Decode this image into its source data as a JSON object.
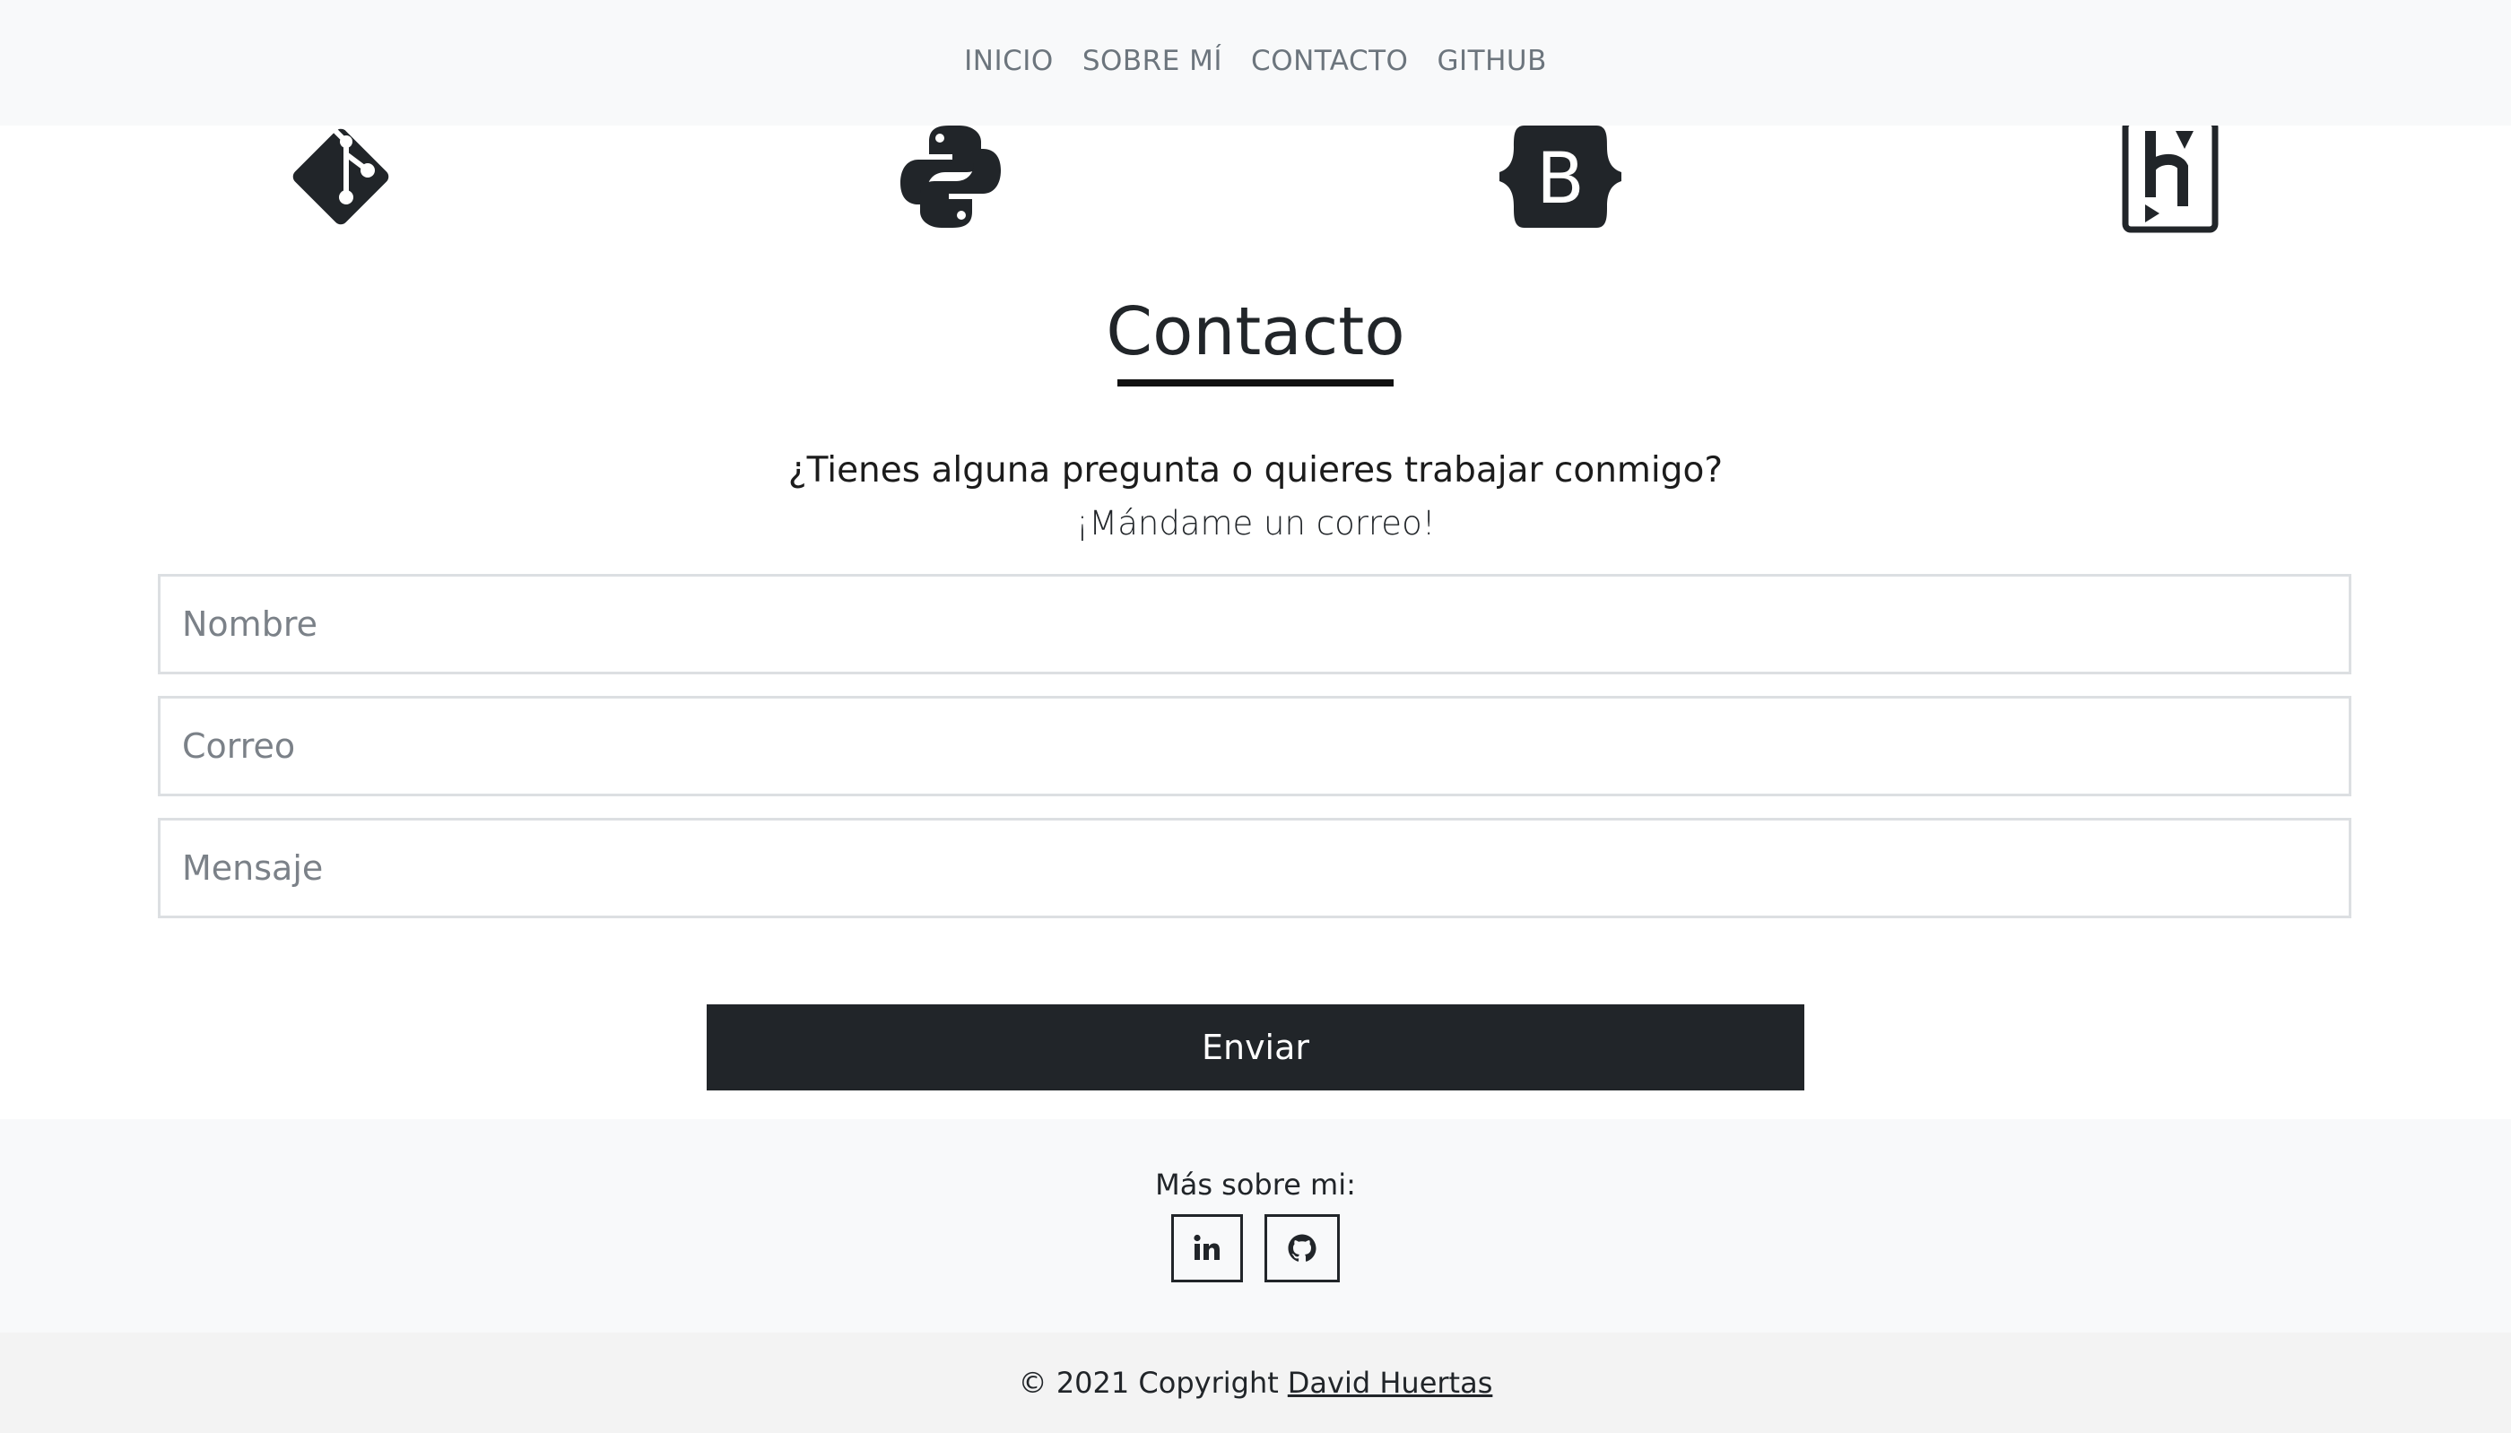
{
  "nav": {
    "items": [
      {
        "label": "INICIO"
      },
      {
        "label": "SOBRE MÍ"
      },
      {
        "label": "CONTACTO"
      },
      {
        "label": "GITHUB"
      }
    ]
  },
  "skills": [
    {
      "icon": "git-icon"
    },
    {
      "icon": "python-icon"
    },
    {
      "icon": "bootstrap-icon"
    },
    {
      "icon": "heroku-icon"
    }
  ],
  "contact": {
    "title": "Contacto",
    "lead": "¿Tienes alguna pregunta o quieres trabajar conmigo?",
    "sub": "¡Mándame un correo!",
    "fields": {
      "name_placeholder": "Nombre",
      "email_placeholder": "Correo",
      "message_placeholder": "Mensaje"
    },
    "submit_label": "Enviar"
  },
  "footer": {
    "label": "Más sobre mi:",
    "social": [
      {
        "icon": "linkedin-icon"
      },
      {
        "icon": "github-icon"
      }
    ],
    "copyright": "© 2021 Copyright",
    "author": "David Huertas"
  },
  "colors": {
    "navbar_bg": "#f8f9fa",
    "dark": "#212529",
    "nav_text": "#6c757d",
    "copyright_bg": "#f3f3f3"
  }
}
